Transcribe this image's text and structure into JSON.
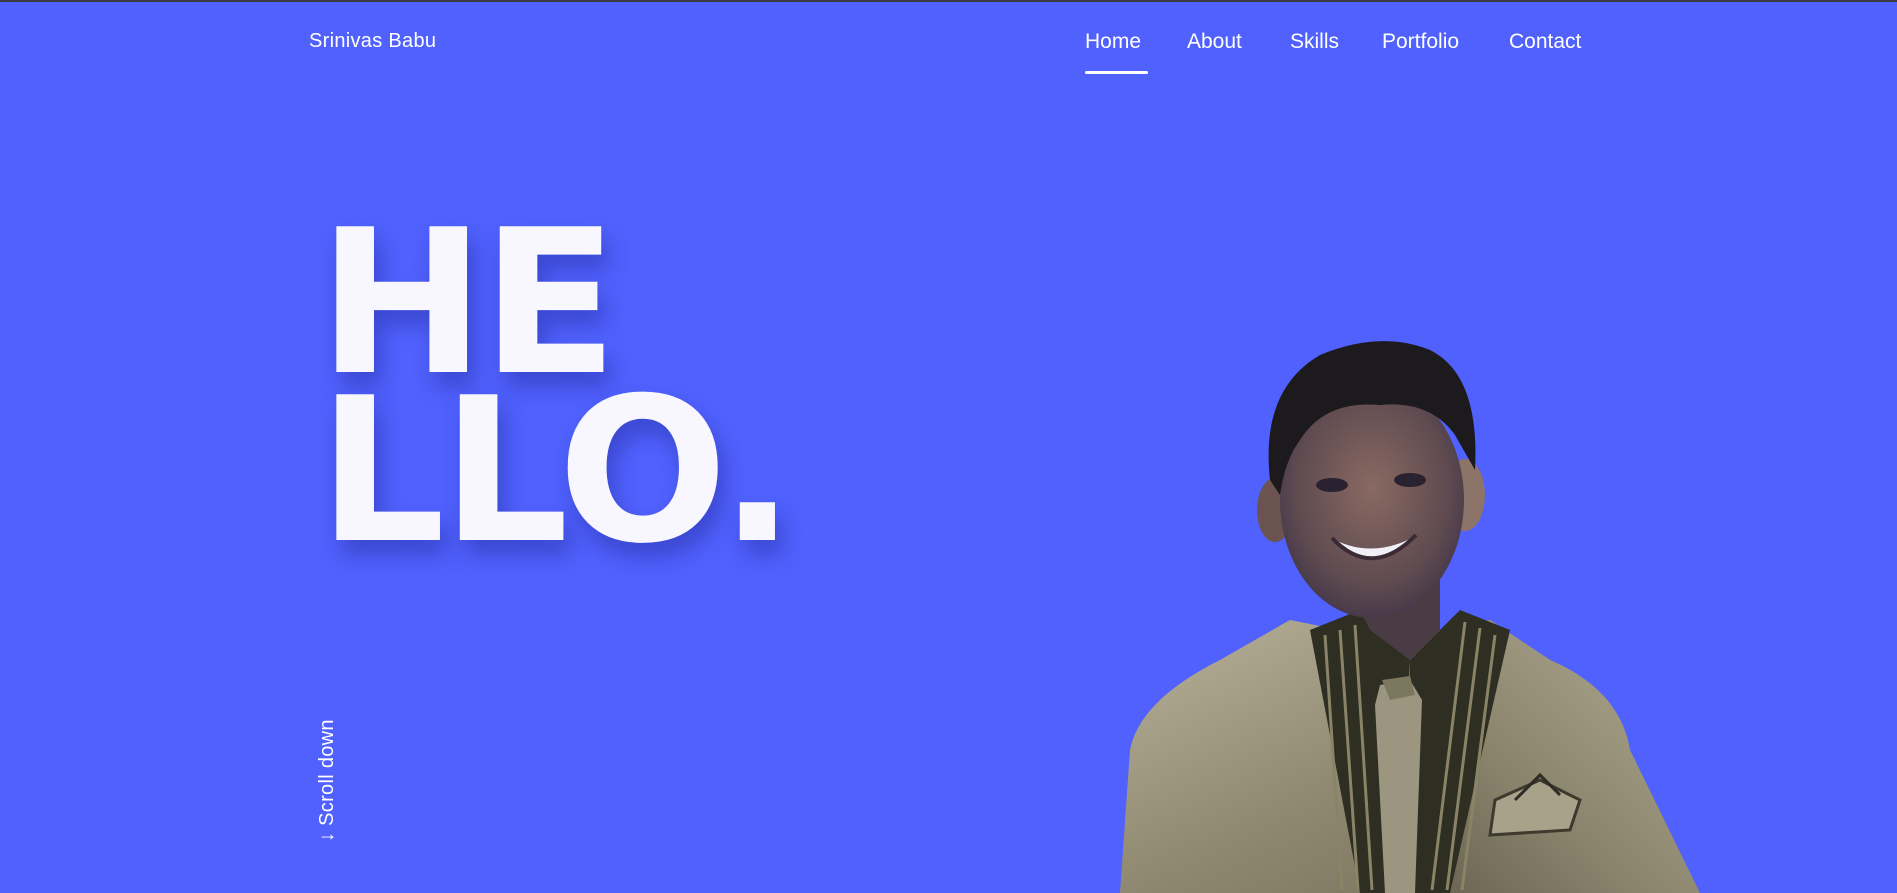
{
  "brand": {
    "name": "Srinivas Babu"
  },
  "nav": {
    "items": [
      {
        "label": "Home",
        "active": true
      },
      {
        "label": "About",
        "active": false
      },
      {
        "label": "Skills",
        "active": false
      },
      {
        "label": "Portfolio",
        "active": false
      },
      {
        "label": "Contact",
        "active": false
      }
    ]
  },
  "hero": {
    "line1": "HE",
    "line2": "LLO.",
    "scroll_label": "↓ Scroll down"
  },
  "colors": {
    "background": "#5061FD",
    "hero_text": "#F8F7FF",
    "nav_text": "#FFFFFF"
  },
  "icons": {
    "scroll": "down-arrow-icon"
  }
}
